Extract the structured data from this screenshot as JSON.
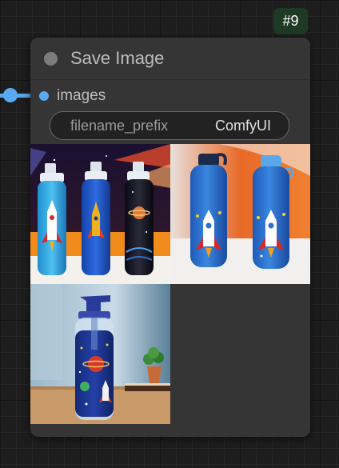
{
  "badge": {
    "node_id": "#9"
  },
  "node": {
    "title": "Save Image",
    "input": {
      "label": "images"
    },
    "widget": {
      "label": "filename_prefix",
      "value": "ComfyUI"
    }
  },
  "preview": {
    "images": [
      {
        "subject": "three rocket-themed water bottles in front of a space-window backdrop"
      },
      {
        "subject": "two blue rocket water bottles on a table with orange backdrop"
      },
      {
        "subject": "clear kids water bottle with space print next to a plant and book"
      }
    ]
  },
  "colors": {
    "canvas": "#1d1d1d",
    "node_body": "#353535",
    "badge_bg": "#1e3a24",
    "link_blue": "#5aa9f0",
    "title_text": "#bdbdbd"
  }
}
